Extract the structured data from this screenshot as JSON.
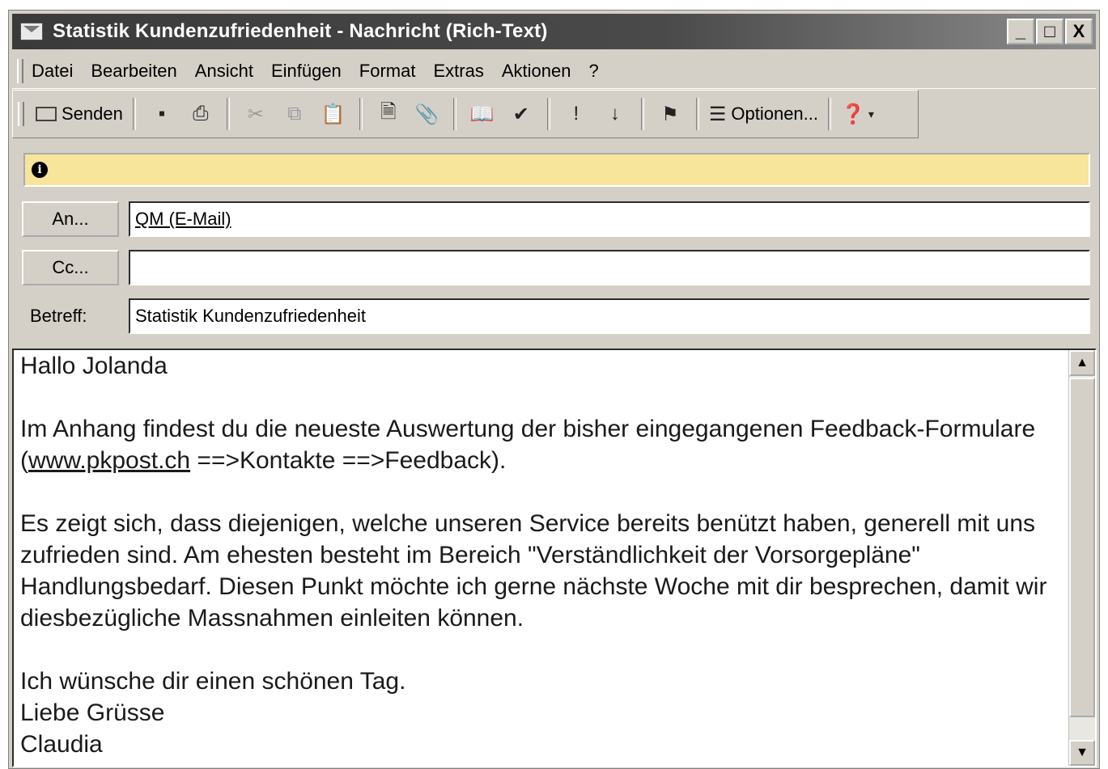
{
  "window": {
    "title": "Statistik Kundenzufriedenheit - Nachricht (Rich-Text)",
    "controls": [
      "_",
      "□",
      "X"
    ]
  },
  "menubar": {
    "items": [
      "Datei",
      "Bearbeiten",
      "Ansicht",
      "Einfügen",
      "Format",
      "Extras",
      "Aktionen",
      "?"
    ]
  },
  "toolbar": {
    "send_label": "Senden",
    "options_label": "Optionen...",
    "icons": [
      "save-icon",
      "print-icon",
      "cut-icon",
      "copy-icon",
      "paste-icon",
      "insert-file-icon",
      "attach-icon",
      "address-book-icon",
      "check-names-icon",
      "importance-high-icon",
      "importance-low-icon",
      "flag-icon",
      "options-icon",
      "help-icon"
    ]
  },
  "infobar": {
    "icon": "info-icon",
    "color": "#f6e59a"
  },
  "fields": {
    "to_label": "An...",
    "to_value": "QM (E-Mail)",
    "cc_label": "Cc...",
    "cc_value": "",
    "subject_label": "Betreff:",
    "subject_value": "Statistik Kundenzufriedenheit"
  },
  "message": {
    "greeting": "Hallo Jolanda",
    "p1_before": "Im Anhang findest du die neueste Auswertung der bisher eingegangenen Feedback-Formulare (",
    "p1_link": "www.pkpost.ch",
    "p1_after": " ==>Kontakte ==>Feedback).",
    "p2": "Es zeigt sich, dass diejenigen, welche unseren Service bereits benützt haben, generell mit uns zufrieden sind. Am ehesten besteht im Bereich \"Verständlichkeit der Vorsorgepläne\" Handlungsbedarf. Diesen Punkt möchte ich gerne nächste Woche mit dir besprechen, damit wir diesbezügliche Massnahmen einleiten können.",
    "closing": "Ich wünsche dir einen schönen Tag.",
    "regards": "Liebe Grüsse",
    "signature": "Claudia"
  }
}
